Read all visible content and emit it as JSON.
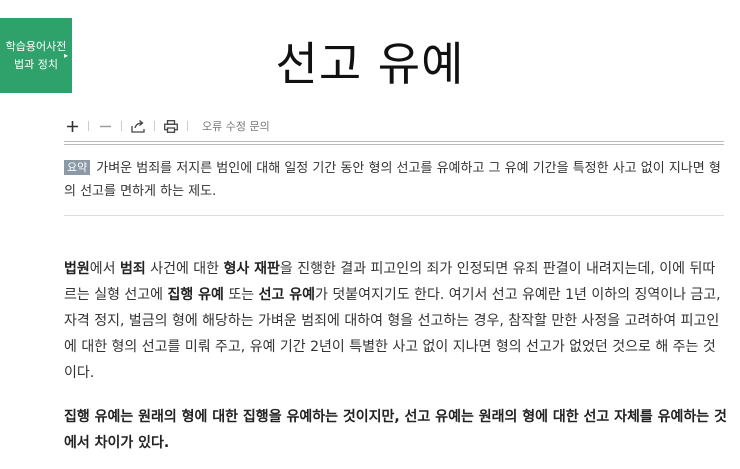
{
  "badge": {
    "line1": "학습용어사전",
    "line2": "법과 정치"
  },
  "title": "선고 유예",
  "toolbar": {
    "report_label": "오류 수정 문의"
  },
  "summary": {
    "tag": "요약",
    "text": "가벼운 범죄를 저지른 범인에 대해 일정 기간 동안 형의 선고를 유예하고 그 유예 기간을 특정한 사고 없이 지나면 형의 선고를 면하게 하는 제도."
  },
  "body": {
    "p1": [
      {
        "t": "법원",
        "b": true
      },
      {
        "t": "에서 ",
        "b": false
      },
      {
        "t": "범죄",
        "b": true
      },
      {
        "t": " 사건에 대한 ",
        "b": false
      },
      {
        "t": "형사 재판",
        "b": true
      },
      {
        "t": "을 진행한 결과 피고인의 죄가 인정되면 유죄 판결이 내려지는데, 이에 뒤따르는 실형 선고에 ",
        "b": false
      },
      {
        "t": "집행 유예",
        "b": true
      },
      {
        "t": " 또는 ",
        "b": false
      },
      {
        "t": "선고 유예",
        "b": true
      },
      {
        "t": "가 덧붙여지기도 한다. 여기서 선고 유예란 1년 이하의 징역이나 금고, 자격 정지, 벌금의 형에 해당하는 가벼운 범죄에 대하여 형을 선고하는 경우, 참작할 만한 사정을 고려하여 피고인에 대한 형의 선고를 미뤄 주고, 유예 기간 2년이 특별한 사고 없이 지나면 형의 선고가 없었던 것으로 해 주는 것이다.",
        "b": false
      }
    ],
    "p2": "집행 유예는 원래의 형에 대한 집행을 유예하는 것이지만, 선고 유예는 원래의 형에 대한 선고 자체를 유예하는 것에서 차이가 있다."
  }
}
